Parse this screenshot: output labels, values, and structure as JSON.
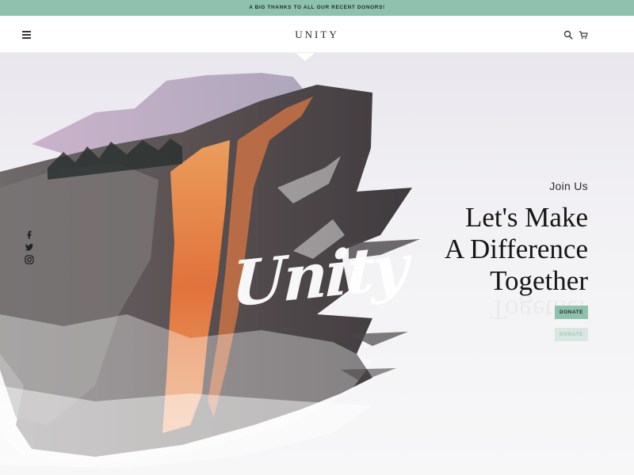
{
  "announcement": {
    "text": "A BIG THANKS TO ALL OUR RECENT DONORS!"
  },
  "header": {
    "logo": "UNITY",
    "menu_icon": "hamburger-icon",
    "search_icon": "search-icon",
    "cart_icon": "cart-icon"
  },
  "hero": {
    "eyebrow": "Join Us",
    "headline_lines": [
      "Let's Make",
      "A Difference",
      "Together"
    ],
    "script_text": "Unity",
    "primary_button": "DONATE",
    "secondary_button": "DONATE"
  },
  "social": {
    "icons": [
      "facebook-icon",
      "twitter-icon",
      "instagram-icon"
    ]
  },
  "colors": {
    "accent": "#8fc2ae",
    "text_dark": "#161616"
  }
}
